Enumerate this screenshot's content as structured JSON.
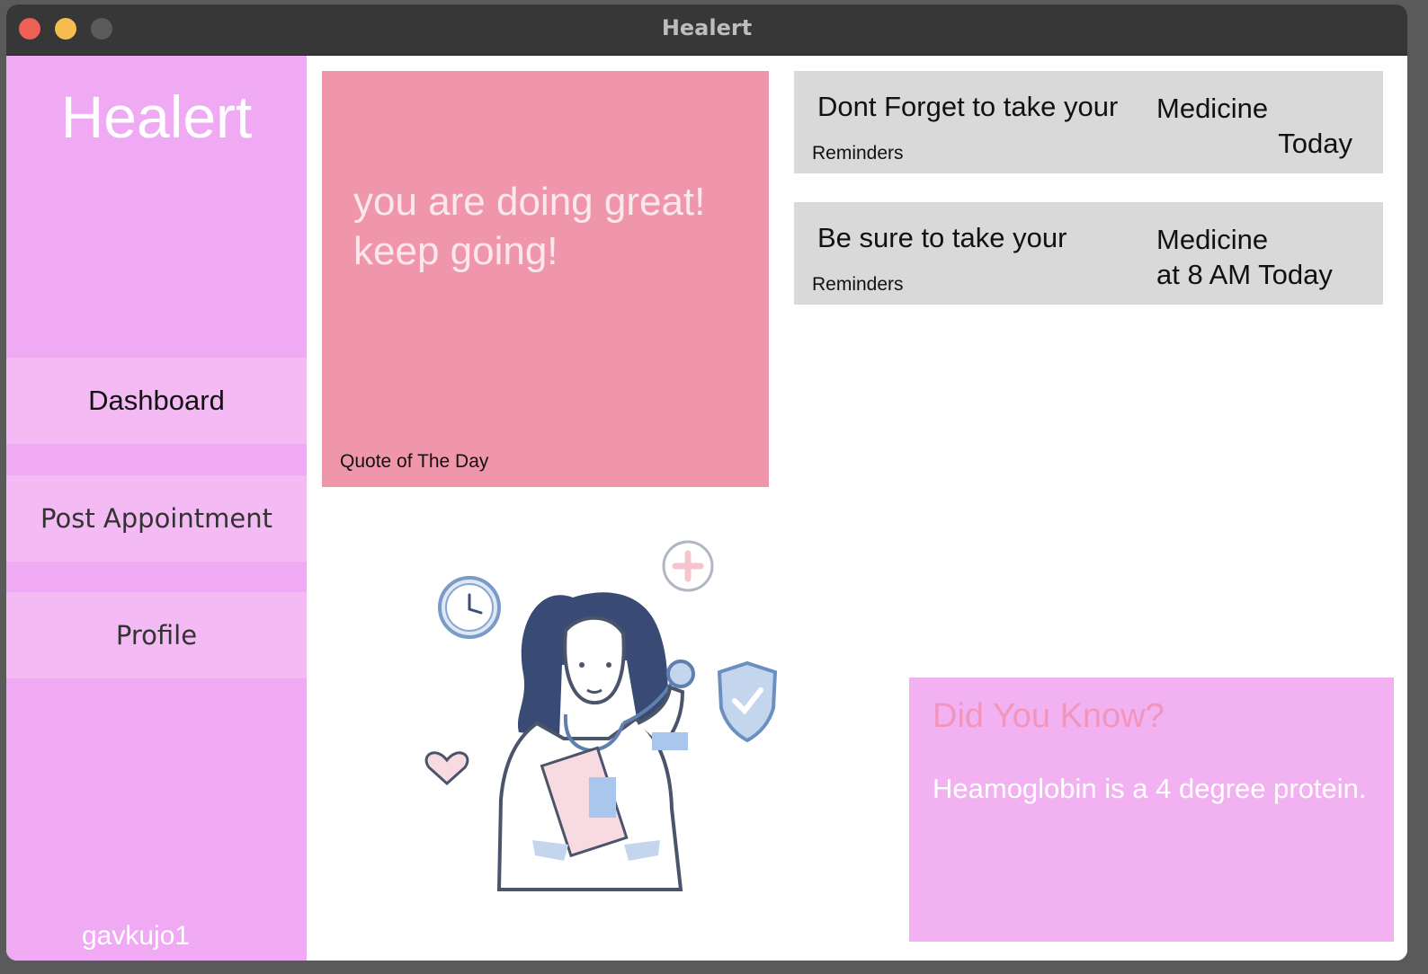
{
  "window": {
    "title": "Healert"
  },
  "sidebar": {
    "logo": "Healert",
    "items": [
      {
        "label": "Dashboard",
        "active": true
      },
      {
        "label": "Post Appointment"
      },
      {
        "label": "Profile"
      }
    ],
    "username": "gavkujo1"
  },
  "quote": {
    "lines": [
      "you are doing great!",
      "keep going!"
    ],
    "label": "Quote of The Day"
  },
  "reminders": [
    {
      "text": "Dont Forget to take your",
      "right_line1": "Medicine",
      "right_line2": "Today",
      "label": "Reminders"
    },
    {
      "text": "Be sure to take your",
      "right_line1": "Medicine",
      "right_line2": "at 8 AM Today",
      "label": "Reminders"
    }
  ],
  "illustration": {
    "icon": "doctor-illustration"
  },
  "fact": {
    "title": "Did You Know?",
    "text": "Heamoglobin is a 4 degree protein."
  },
  "colors": {
    "sidebar": "#f0aaf3",
    "nav_item": "#f3baf3",
    "quote_card": "#f096aa",
    "reminder_card": "#d9d9d9",
    "fact_card": "#f2b2f1",
    "fact_title": "#f295bd"
  }
}
